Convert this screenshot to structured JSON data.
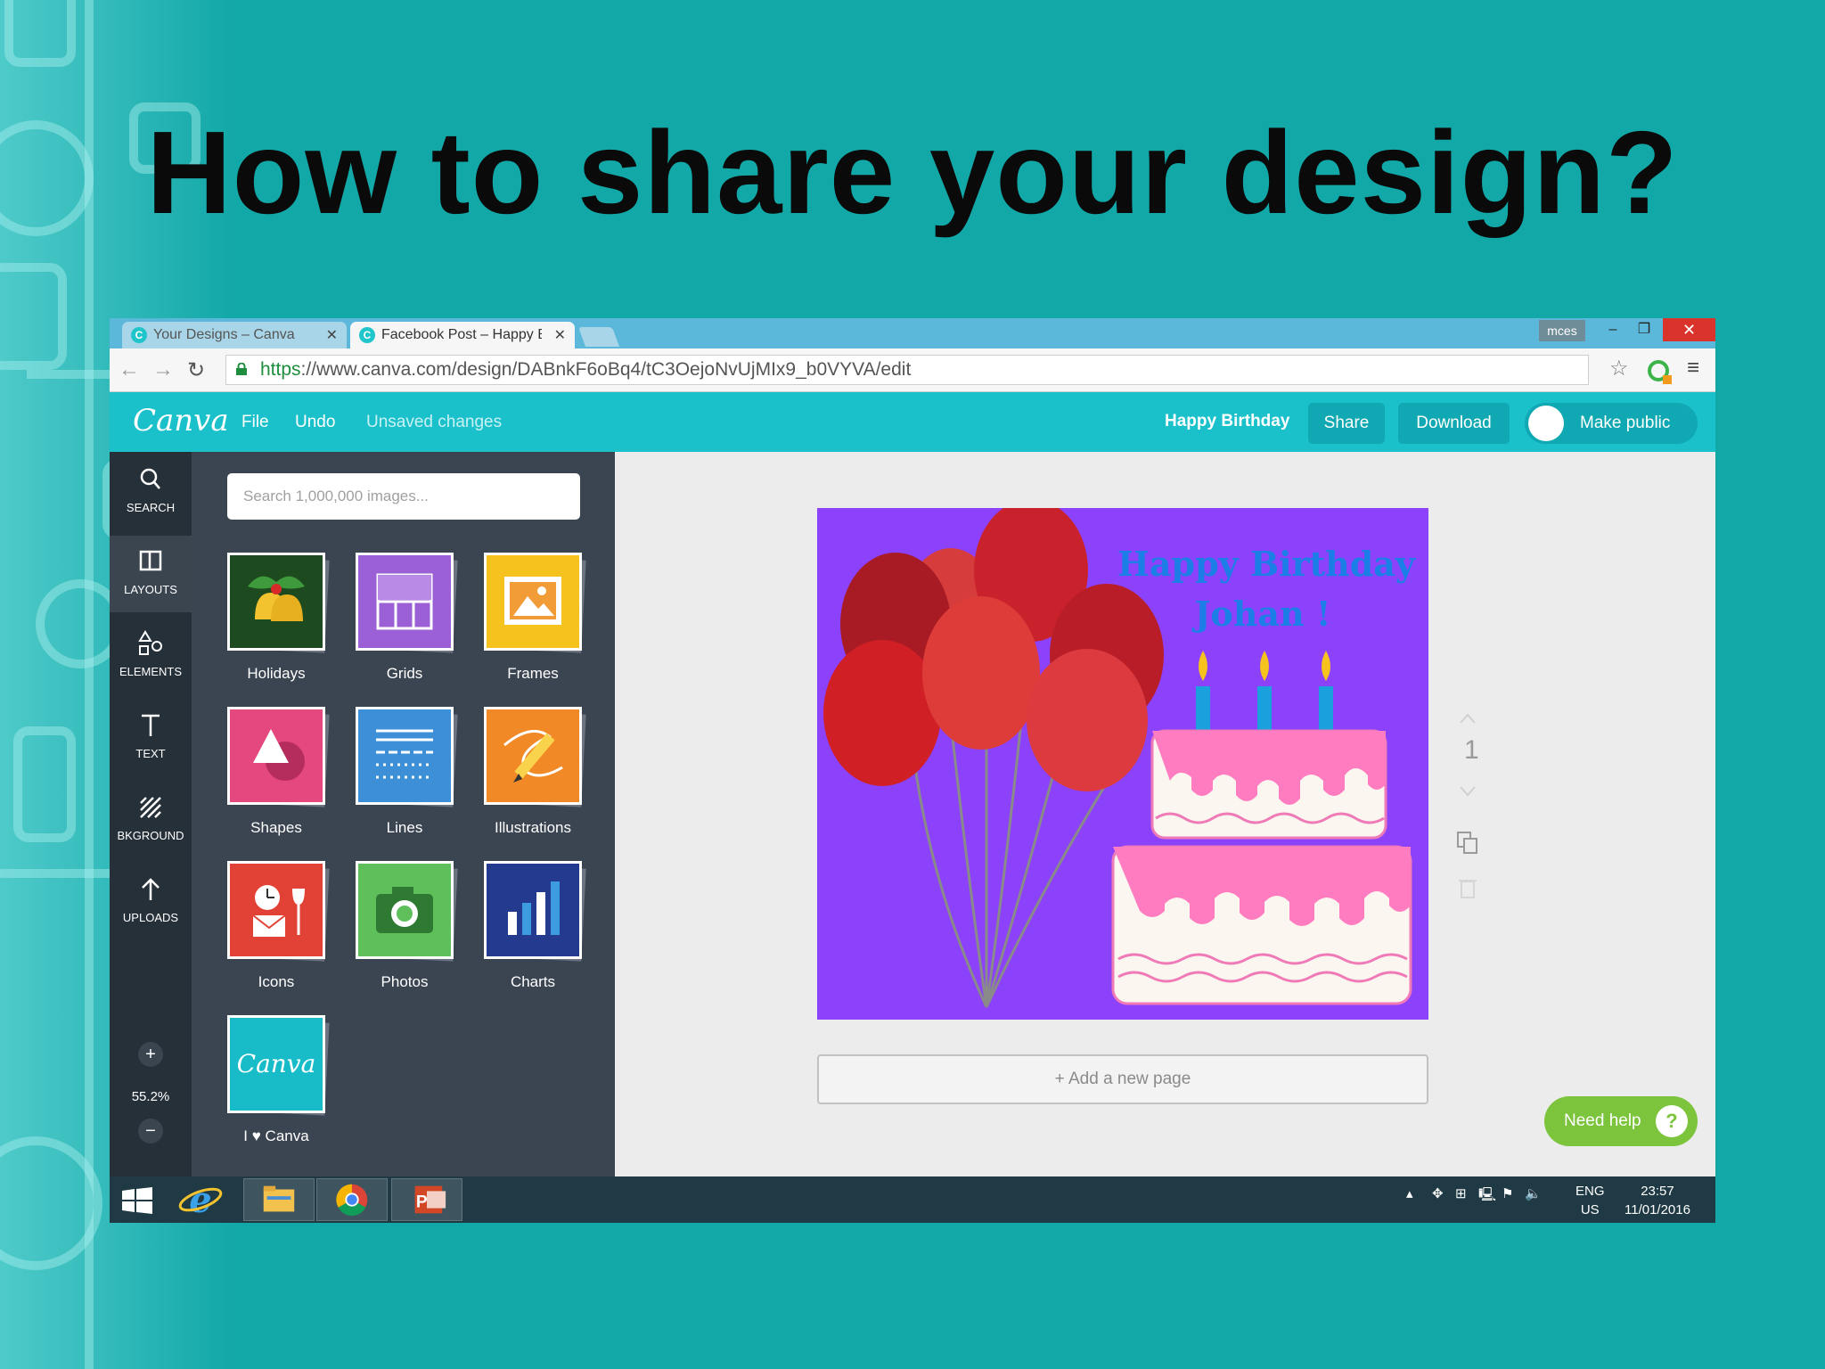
{
  "slide": {
    "title": "How to share your design?"
  },
  "browser": {
    "tabs": [
      {
        "title": "Your Designs – Canva",
        "active": false
      },
      {
        "title": "Facebook Post – Happy Bi",
        "active": true
      }
    ],
    "user": "mces",
    "url_scheme": "https",
    "url_rest": "://www.canva.com/design/DABnkF6oBq4/tC3OejoNvUjMIx9_b0VYVA/edit"
  },
  "canva": {
    "logo": "Canva",
    "menu": {
      "file": "File",
      "undo": "Undo",
      "status": "Unsaved changes"
    },
    "design_name": "Happy Birthday",
    "share_label": "Share",
    "download_label": "Download",
    "make_public_label": "Make public",
    "rail": [
      {
        "label": "SEARCH",
        "icon": "search-icon"
      },
      {
        "label": "LAYOUTS",
        "icon": "layouts-icon"
      },
      {
        "label": "ELEMENTS",
        "icon": "elements-icon"
      },
      {
        "label": "TEXT",
        "icon": "text-icon"
      },
      {
        "label": "BKGROUND",
        "icon": "background-icon"
      },
      {
        "label": "UPLOADS",
        "icon": "upload-icon"
      }
    ],
    "zoom": {
      "plus": "+",
      "level": "55.2%",
      "minus": "−"
    },
    "search_placeholder": "Search 1,000,000 images...",
    "tiles": [
      {
        "label": "Holidays",
        "color": "#1d4a1e"
      },
      {
        "label": "Grids",
        "color": "#9b5fd6"
      },
      {
        "label": "Frames",
        "color": "#f6c21e"
      },
      {
        "label": "Shapes",
        "color": "#e5477f"
      },
      {
        "label": "Lines",
        "color": "#3d8fd8"
      },
      {
        "label": "Illustrations",
        "color": "#f18a26"
      },
      {
        "label": "Icons",
        "color": "#e24235"
      },
      {
        "label": "Photos",
        "color": "#5fbf5a"
      },
      {
        "label": "Charts",
        "color": "#233a8f"
      },
      {
        "label": "I ♥ Canva",
        "color": "#17bcc8",
        "logo_text": "Canva"
      }
    ],
    "artboard": {
      "line1": "Happy Birthday",
      "line2": "Johan !"
    },
    "page_number": "1",
    "add_page": "+ Add a new page",
    "help_label": "Need help",
    "help_icon": "?"
  },
  "taskbar": {
    "lang1": "ENG",
    "lang2": "US",
    "time": "23:57",
    "date": "11/01/2016"
  }
}
